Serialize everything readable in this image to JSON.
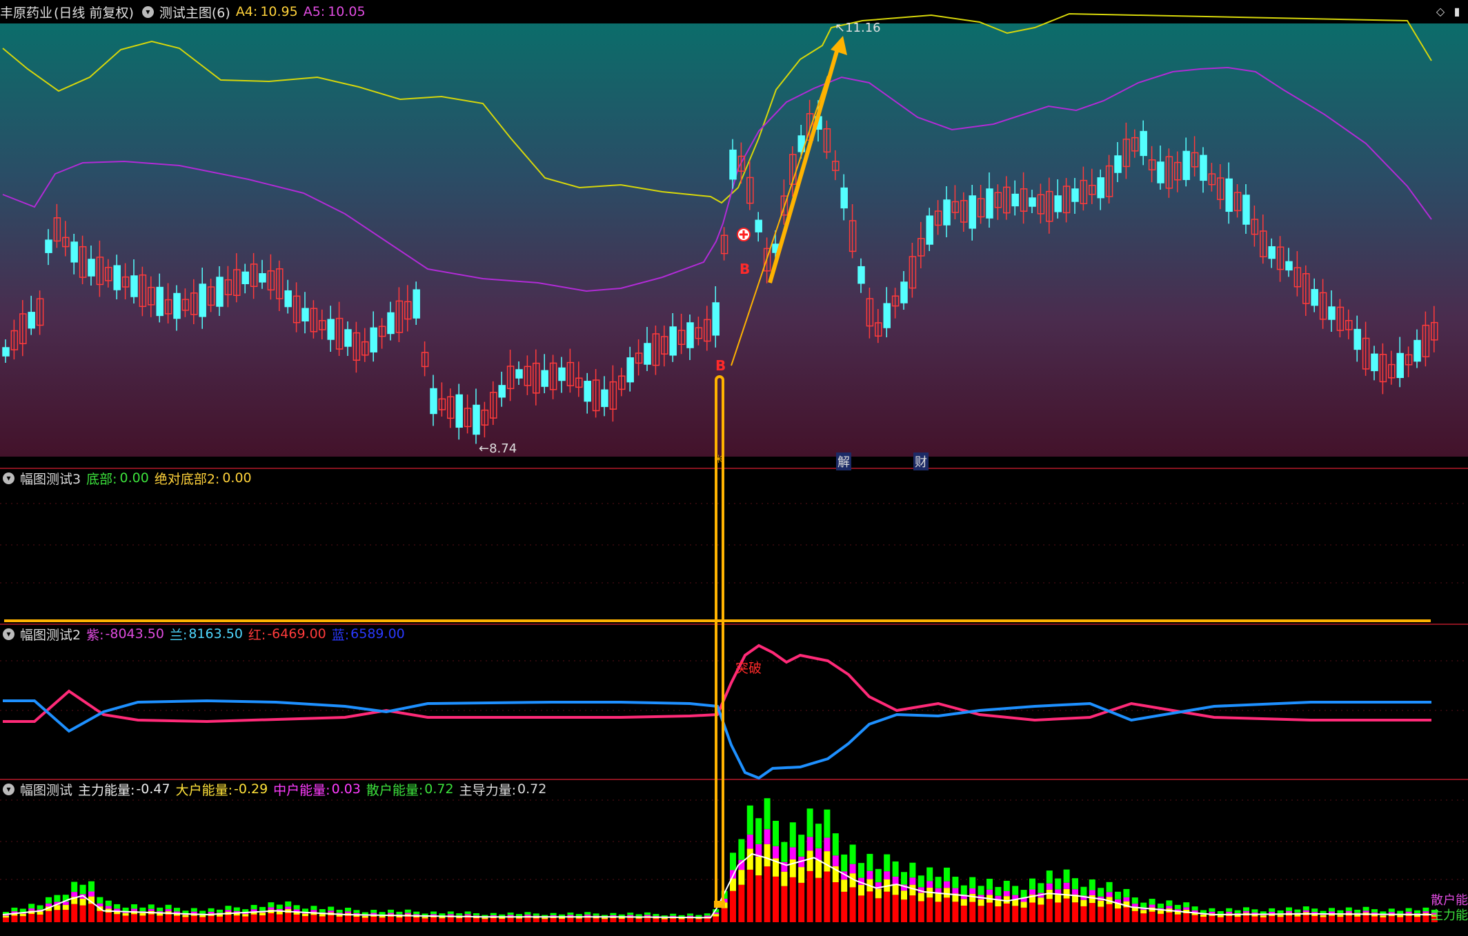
{
  "main": {
    "stock_name": "丰原药业",
    "period": "(日线 前复权)",
    "indicator": "测试主图(6)",
    "a4_label": "A4:",
    "a4_value": "10.95",
    "a5_label": "A5:",
    "a5_value": "10.05",
    "high_label": "11.16",
    "low_label": "8.74",
    "marker_b": "B",
    "marker_b2": "B",
    "event_jie": "解",
    "event_cai": "财",
    "event_star": "✳"
  },
  "panel3": {
    "title": "幅图测试3",
    "dibu_label": "底部:",
    "dibu_value": "0.00",
    "abs_label": "绝对底部2:",
    "abs_value": "0.00"
  },
  "panel2": {
    "title": "幅图测试2",
    "zi_label": "紫:",
    "zi_value": "-8043.50",
    "lan_label": "兰:",
    "lan_value": "8163.50",
    "hong_label": "红:",
    "hong_value": "-6469.00",
    "lan2_label": "蓝:",
    "lan2_value": "6589.00",
    "breakthrough": "突破"
  },
  "panel1": {
    "title": "幅图测试",
    "zl_label": "主力能量:",
    "zl_value": "-0.47",
    "dh_label": "大户能量:",
    "dh_value": "-0.29",
    "zh_label": "中户能量:",
    "zh_value": "0.03",
    "sh_label": "散户能量:",
    "sh_value": "0.72",
    "zd_label": "主导力量:",
    "zd_value": "0.72",
    "side_sanhu": "散户能",
    "side_zhuli": "主力能"
  },
  "colors": {
    "up": "#ff3b3b",
    "down": "#54ffff",
    "yellow_line": "#d7d70a",
    "purple_line": "#b12bd6",
    "annotation": "#ffb300",
    "red_line": "#ff2a78",
    "blue_line": "#1e90ff",
    "bar_red": "#ff0000",
    "bar_yellow": "#ffff00",
    "bar_magenta": "#ff00ff",
    "bar_green": "#00ff00"
  },
  "icons": [
    "chevron-down-icon",
    "diamond-icon",
    "scroll-right-icon",
    "add-circle-icon",
    "arrow-icon"
  ]
}
